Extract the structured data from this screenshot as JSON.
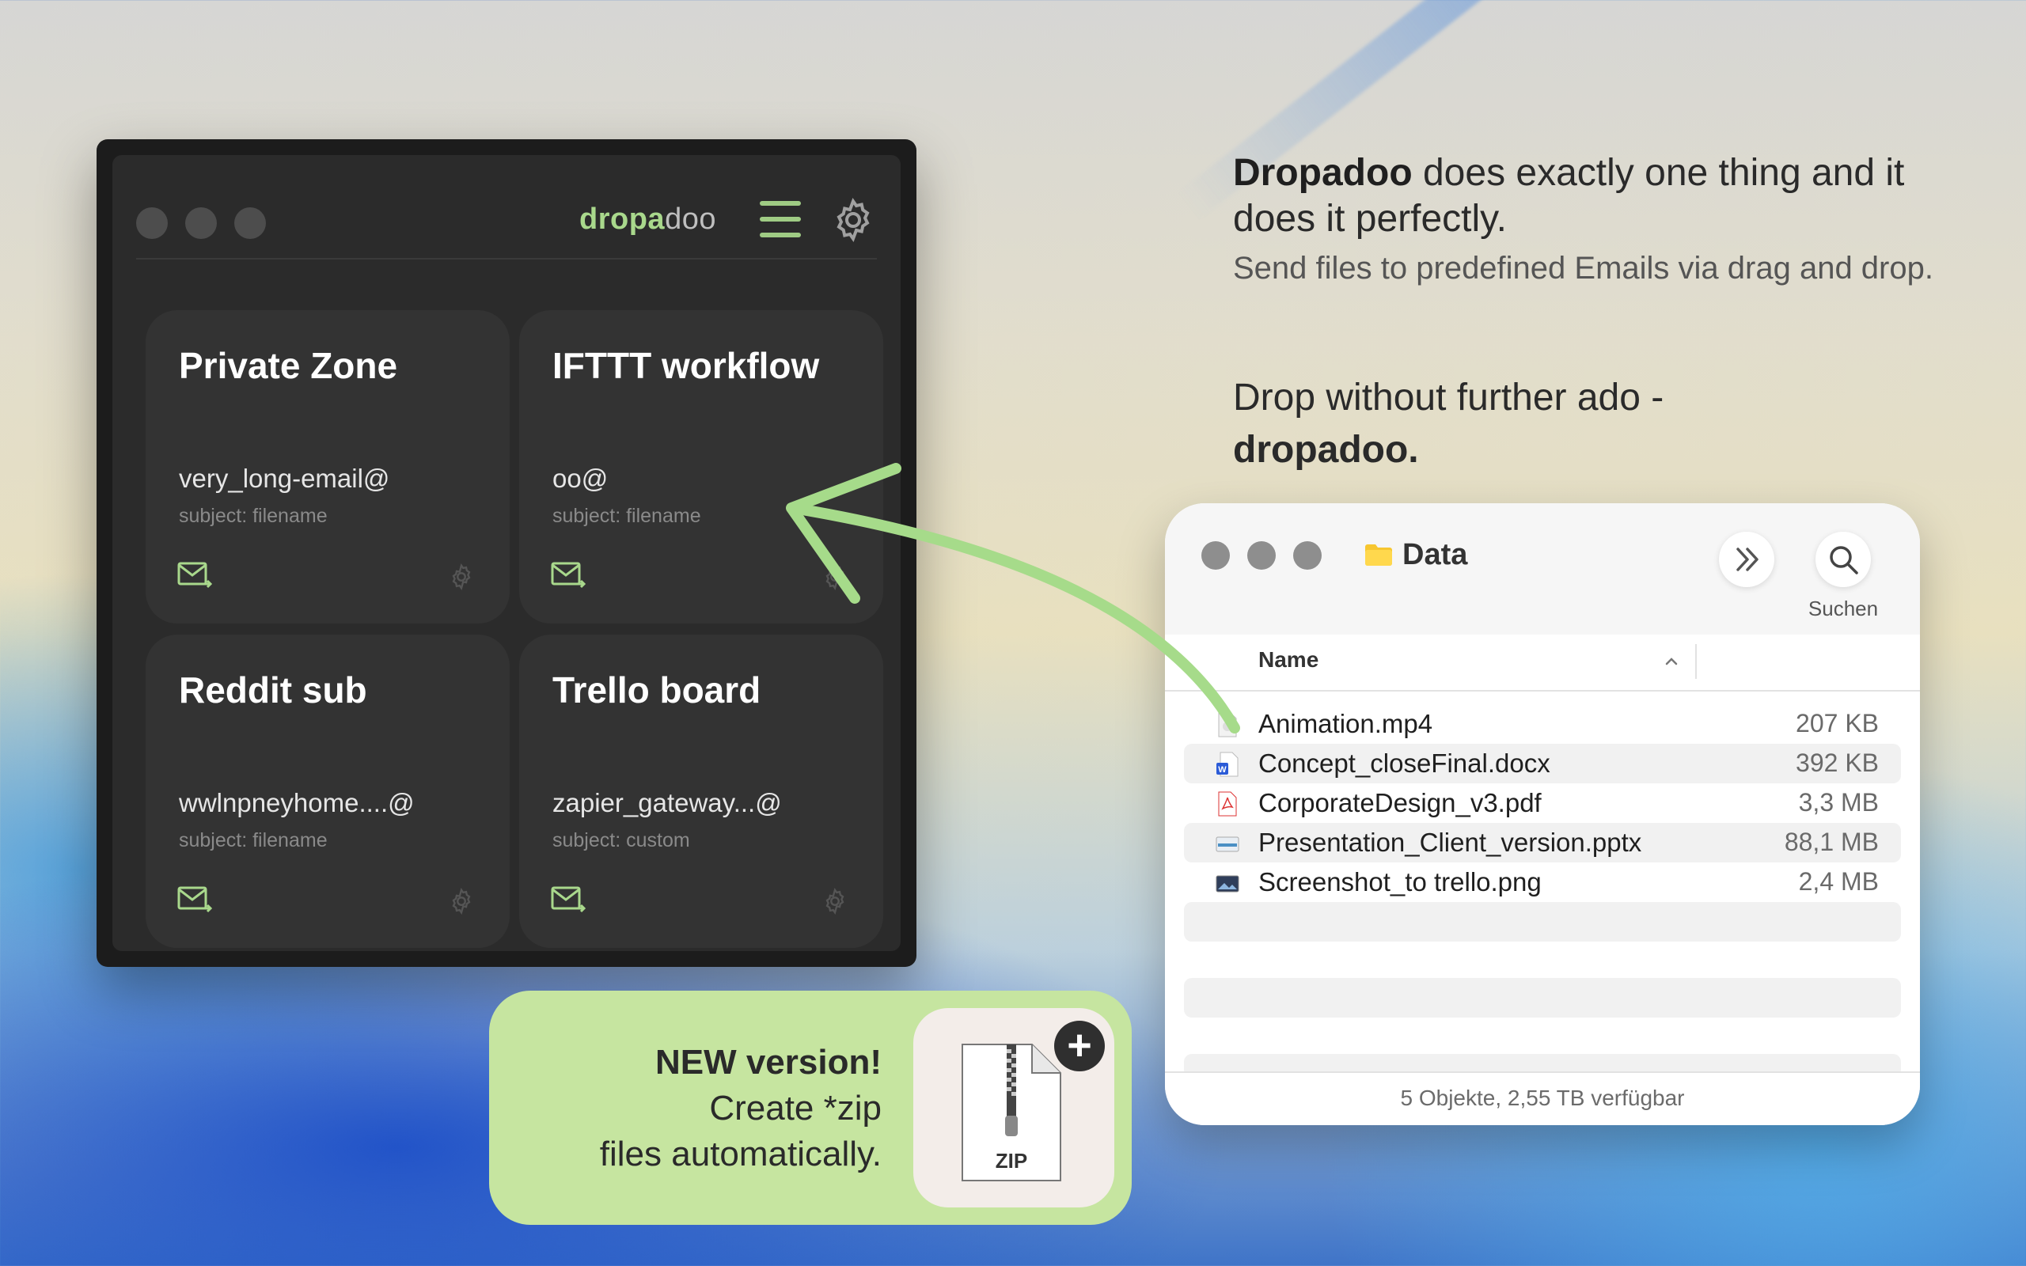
{
  "app": {
    "brand_part1": "dropa",
    "brand_part2": "doo",
    "cards": [
      {
        "title": "Private Zone",
        "email": "very_long-email@",
        "subject": "subject: filename"
      },
      {
        "title": "IFTTT workflow",
        "email": "oo@",
        "subject": "subject: filename"
      },
      {
        "title": "Reddit sub",
        "email": "wwlnpneyhome....@",
        "subject": "subject: filename"
      },
      {
        "title": "Trello board",
        "email": "zapier_gateway...@",
        "subject": "subject: custom"
      }
    ],
    "colors": {
      "accent": "#a9d88c",
      "bg": "#2b2b2b",
      "card": "#333333"
    }
  },
  "marketing": {
    "headline_brand": "Dropadoo",
    "headline_rest": " does exactly one thing and it does it perfectly.",
    "subline": "Send files to predefined Emails via drag and drop.",
    "tagline": "Drop without further ado -",
    "tagline_brand": "dropadoo."
  },
  "finder": {
    "title": "Data",
    "search_label": "Suchen",
    "column_name": "Name",
    "files": [
      {
        "name": "Animation.mp4",
        "size": "207 KB",
        "icon": "video-file-icon"
      },
      {
        "name": "Concept_closeFinal.docx",
        "size": "392 KB",
        "icon": "word-file-icon"
      },
      {
        "name": "CorporateDesign_v3.pdf",
        "size": "3,3 MB",
        "icon": "pdf-file-icon"
      },
      {
        "name": "Presentation_Client_version.pptx",
        "size": "88,1 MB",
        "icon": "presentation-file-icon"
      },
      {
        "name": "Screenshot_to trello.png",
        "size": "2,4 MB",
        "icon": "image-file-icon"
      }
    ],
    "status": "5 Objekte, 2,55 TB verfügbar"
  },
  "promo": {
    "new": "NEW version!",
    "line2": "Create *zip",
    "line3": "files automatically.",
    "zip_label": "ZIP",
    "plus": "+"
  }
}
